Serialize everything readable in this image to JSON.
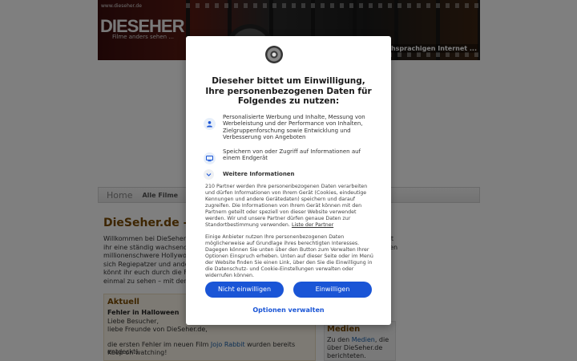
{
  "page": {
    "banner": {
      "logo_small": "www.dieseher.de",
      "logo": "DIESEHER",
      "logo_sub": "Filme anders sehen ...",
      "tagline": "deutschsprachigen Internet ..."
    },
    "nav": {
      "home": "Home",
      "items": [
        "Alle Filme",
        "A"
      ]
    },
    "title": "DieSeher.de - F",
    "intro_lines": [
      "Willkommen bei DieSeher.de,",
      "ihr eine ständig wachsende L",
      "millionenschwere Hollywood-",
      "sich Regiepatzer und andere",
      "könnt ihr euch durch die Fehl",
      "einmal zu sehen – mit den Au"
    ],
    "intro_right": [
      "et",
      "",
      "ten",
      "n"
    ],
    "aktuell": {
      "heading": "Aktuell",
      "item_title": "Fehler in Halloween",
      "line1": "Liebe Besucher,",
      "line2": "liebe Freunde von DieSeher.de,",
      "line3_pre": "die ersten Fehler im neuen Film ",
      "line3_link": "Jojo Rabbit",
      "line3_post": " wurden bereits entdeckt!",
      "line4": "Keep on watching!"
    },
    "medien": {
      "heading": "Medien",
      "line1_pre": "Zu den ",
      "line1_link": "Medien",
      "line1_post": ", die",
      "line2": "über DieSeher.de",
      "line3": "berichteten."
    }
  },
  "consent": {
    "title": "Dieseher bittet um Einwilligung, Ihre personenbezogenen Daten für Folgendes zu nutzen:",
    "purposes": [
      {
        "icon": "person-icon",
        "text": "Personalisierte Werbung und Inhalte, Messung von Werbeleistung und der Performance von Inhalten, Zielgruppenforschung sowie Entwicklung und Verbesserung von Angeboten"
      },
      {
        "icon": "device-icon",
        "text": "Speichern von oder Zugriff auf Informationen auf einem Endgerät"
      }
    ],
    "more_label": "Weitere Informationen",
    "para1": "210 Partner werden Ihre personenbezogenen Daten verarbeiten und dürfen Informationen von Ihrem Gerät (Cookies, eindeutige Kennungen und andere Gerätedaten) speichern und darauf zugreifen. Die Informationen von Ihrem Gerät können mit den Partnern geteilt oder speziell von dieser Website verwendet werden. Wir und unsere Partner dürfen genaue Daten zur Standortbestimmung verwenden.",
    "para1_link": "Liste der Partner",
    "para2": "Einige Anbieter nutzen Ihre personenbezogenen Daten möglicherweise auf Grundlage ihres berechtigten Interesses. Dagegen können Sie unten über den Button zum Verwalten Ihrer Optionen Einspruch erheben. Unten auf dieser Seite oder im Menü der Website finden Sie einen Link, über den Sie die Einwilligung in die Datenschutz- und Cookie-Einstellungen verwalten oder widerrufen können.",
    "reject_label": "Nicht einwilligen",
    "accept_label": "Einwilligen",
    "manage_label": "Optionen verwalten"
  }
}
